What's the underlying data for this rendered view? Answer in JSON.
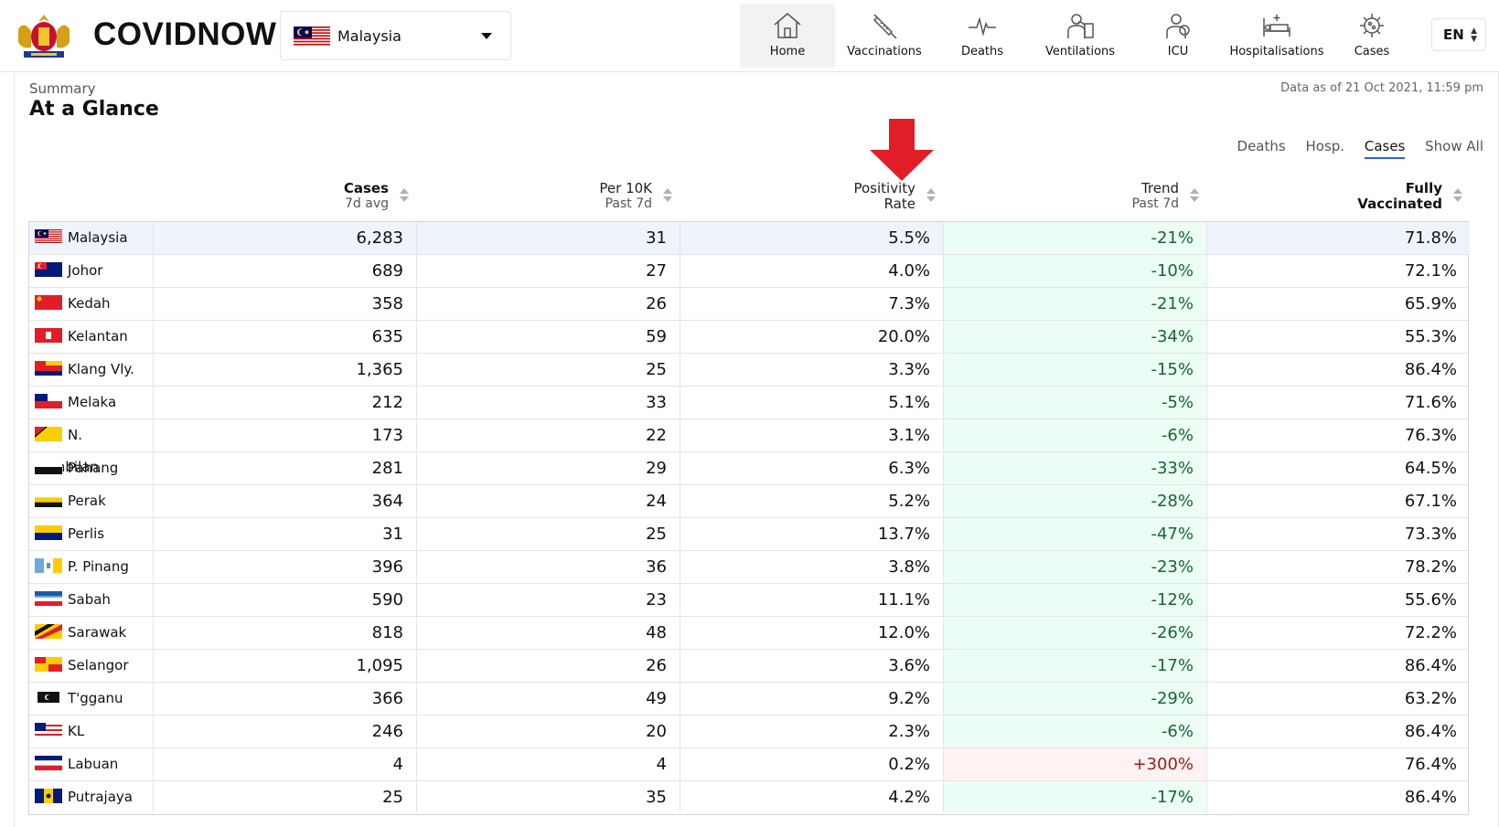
{
  "brand": "COVIDNOW",
  "country_select": {
    "value": "Malaysia"
  },
  "nav": [
    {
      "label": "Home",
      "icon": "home-icon",
      "active": true
    },
    {
      "label": "Vaccinations",
      "icon": "syringe-icon"
    },
    {
      "label": "Deaths",
      "icon": "pulse-icon"
    },
    {
      "label": "Ventilations",
      "icon": "ventilator-icon"
    },
    {
      "label": "ICU",
      "icon": "icu-icon"
    },
    {
      "label": "Hospitalisations",
      "icon": "hospital-bed-icon"
    },
    {
      "label": "Cases",
      "icon": "virus-icon"
    }
  ],
  "language": "EN",
  "summary_label": "Summary",
  "page_title": "At a Glance",
  "data_as_of": "Data as of 21 Oct 2021, 11:59 pm",
  "filters": [
    "Deaths",
    "Hosp.",
    "Cases",
    "Show All"
  ],
  "active_filter": "Cases",
  "columns": [
    {
      "label": "Cases",
      "sub": "7d avg",
      "bold": true
    },
    {
      "label": "Per 10K",
      "sub": "Past 7d"
    },
    {
      "label": "Positivity",
      "sub": "Rate"
    },
    {
      "label": "Trend",
      "sub": "Past 7d"
    },
    {
      "label": "Fully",
      "sub": "Vaccinated",
      "bold": true
    }
  ],
  "rows": [
    {
      "name": "Malaysia",
      "cases": "6,283",
      "per10k": "31",
      "positivity": "5.5%",
      "trend": "-21%",
      "vaccinated": "71.8%"
    },
    {
      "name": "Johor",
      "cases": "689",
      "per10k": "27",
      "positivity": "4.0%",
      "trend": "-10%",
      "vaccinated": "72.1%"
    },
    {
      "name": "Kedah",
      "cases": "358",
      "per10k": "26",
      "positivity": "7.3%",
      "trend": "-21%",
      "vaccinated": "65.9%"
    },
    {
      "name": "Kelantan",
      "cases": "635",
      "per10k": "59",
      "positivity": "20.0%",
      "trend": "-34%",
      "vaccinated": "55.3%"
    },
    {
      "name": "Klang Vly.",
      "cases": "1,365",
      "per10k": "25",
      "positivity": "3.3%",
      "trend": "-15%",
      "vaccinated": "86.4%"
    },
    {
      "name": "Melaka",
      "cases": "212",
      "per10k": "33",
      "positivity": "5.1%",
      "trend": "-5%",
      "vaccinated": "71.6%"
    },
    {
      "name": "N. Sembilan",
      "cases": "173",
      "per10k": "22",
      "positivity": "3.1%",
      "trend": "-6%",
      "vaccinated": "76.3%"
    },
    {
      "name": "Pahang",
      "cases": "281",
      "per10k": "29",
      "positivity": "6.3%",
      "trend": "-33%",
      "vaccinated": "64.5%"
    },
    {
      "name": "Perak",
      "cases": "364",
      "per10k": "24",
      "positivity": "5.2%",
      "trend": "-28%",
      "vaccinated": "67.1%"
    },
    {
      "name": "Perlis",
      "cases": "31",
      "per10k": "25",
      "positivity": "13.7%",
      "trend": "-47%",
      "vaccinated": "73.3%"
    },
    {
      "name": "P. Pinang",
      "cases": "396",
      "per10k": "36",
      "positivity": "3.8%",
      "trend": "-23%",
      "vaccinated": "78.2%"
    },
    {
      "name": "Sabah",
      "cases": "590",
      "per10k": "23",
      "positivity": "11.1%",
      "trend": "-12%",
      "vaccinated": "55.6%"
    },
    {
      "name": "Sarawak",
      "cases": "818",
      "per10k": "48",
      "positivity": "12.0%",
      "trend": "-26%",
      "vaccinated": "72.2%"
    },
    {
      "name": "Selangor",
      "cases": "1,095",
      "per10k": "26",
      "positivity": "3.6%",
      "trend": "-17%",
      "vaccinated": "86.4%"
    },
    {
      "name": "T'gganu",
      "cases": "366",
      "per10k": "49",
      "positivity": "9.2%",
      "trend": "-29%",
      "vaccinated": "63.2%"
    },
    {
      "name": "KL",
      "cases": "246",
      "per10k": "20",
      "positivity": "2.3%",
      "trend": "-6%",
      "vaccinated": "86.4%"
    },
    {
      "name": "Labuan",
      "cases": "4",
      "per10k": "4",
      "positivity": "0.2%",
      "trend": "+300%",
      "vaccinated": "76.4%"
    },
    {
      "name": "Putrajaya",
      "cases": "25",
      "per10k": "35",
      "positivity": "4.2%",
      "trend": "-17%",
      "vaccinated": "86.4%"
    }
  ],
  "colors": {
    "trend_down_bg": "#ecfdf5",
    "trend_down_text": "#166534",
    "trend_up_bg": "#fef2f2",
    "trend_up_text": "#991b1b",
    "annotation_arrow": "#e11d28",
    "active_tab_underline": "#2563eb"
  },
  "annotation": {
    "icon": "red-down-arrow-icon",
    "points_to": "Positivity Rate"
  }
}
